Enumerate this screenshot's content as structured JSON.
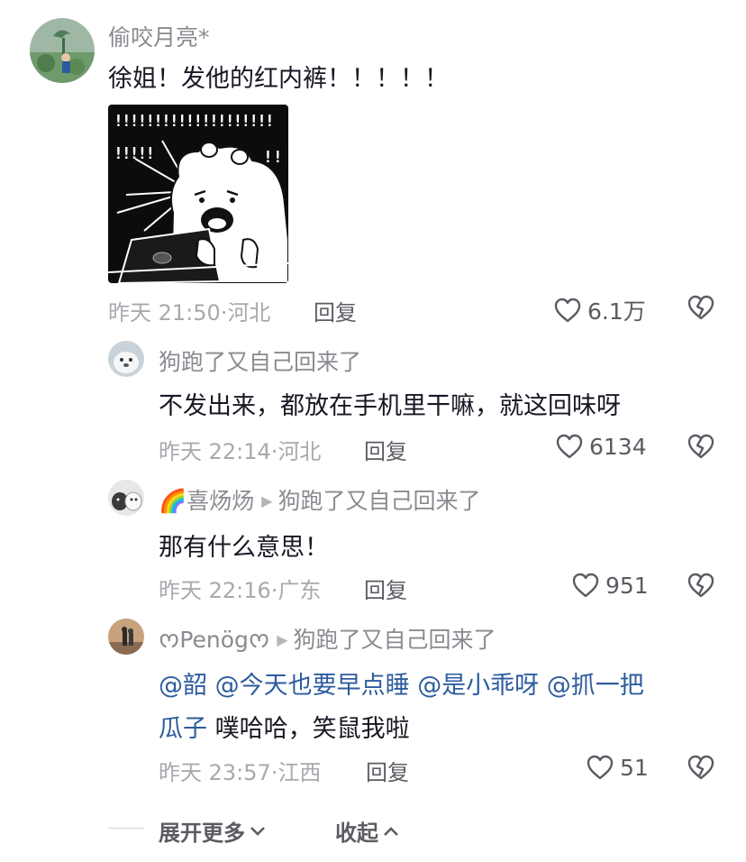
{
  "comments": [
    {
      "username": "偷咬月亮*",
      "text": "徐姐！发他的红内裤！！！！！",
      "sticker_text": [
        "!!!!!!!!!!!!!!!!!!!!",
        "!!!!!"
      ],
      "time": "昨天 21:50",
      "location": "河北",
      "reply_label": "回复",
      "likes": "6.1万"
    },
    {
      "username": "狗跑了又自己回来了",
      "text": "不发出来，都放在手机里干嘛，就这回味呀",
      "time": "昨天 22:14",
      "location": "河北",
      "reply_label": "回复",
      "likes": "6134"
    },
    {
      "username": "🌈喜炀炀",
      "reply_to": "狗跑了又自己回来了",
      "text": "那有什么意思！",
      "time": "昨天 22:16",
      "location": "广东",
      "reply_label": "回复",
      "likes": "951"
    },
    {
      "username": "ᰔPenögᰔ",
      "reply_to": "狗跑了又自己回来了",
      "mentions": [
        "@韶",
        "@今天也要早点睡",
        "@是小乖呀",
        "@抓一把",
        "瓜子"
      ],
      "text_after": " 噗哈哈，笑鼠我啦",
      "time": "昨天 23:57",
      "location": "江西",
      "reply_label": "回复",
      "likes": "51"
    }
  ],
  "footer": {
    "expand_label": "展开更多",
    "collapse_label": "收起"
  },
  "colors": {
    "mention": "#2d5c9e",
    "meta": "#a8a9ae",
    "text": "#161823"
  },
  "icons": [
    "heart-icon",
    "broken-heart-icon",
    "chevron-down-icon",
    "chevron-up-icon",
    "play-triangle-icon"
  ]
}
